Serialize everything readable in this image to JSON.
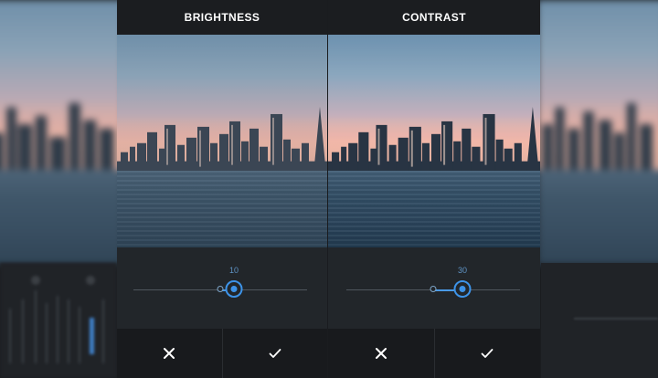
{
  "panels": [
    {
      "title": "BRIGHTNESS",
      "value_label": "10",
      "slider": {
        "min": -100,
        "max": 100,
        "value": 10
      },
      "cancel_icon": "close-icon",
      "confirm_icon": "checkmark-icon"
    },
    {
      "title": "CONTRAST",
      "value_label": "30",
      "slider": {
        "min": -100,
        "max": 100,
        "value": 30
      },
      "cancel_icon": "close-icon",
      "confirm_icon": "checkmark-icon"
    }
  ],
  "colors": {
    "accent": "#3d93e8",
    "panel_bg": "#1f2226",
    "title_bar_bg": "#1b1d20",
    "action_bar_bg": "#181a1d"
  }
}
